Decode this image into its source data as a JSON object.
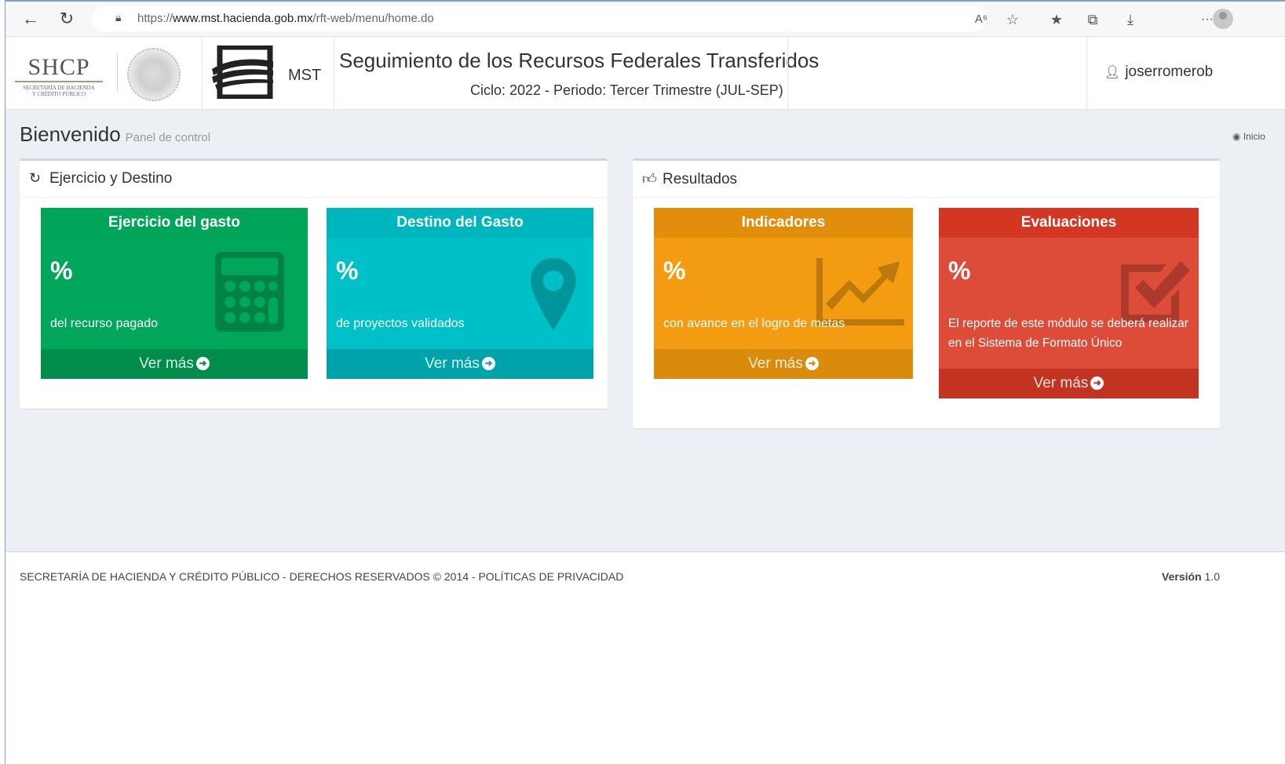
{
  "browser": {
    "url_scheme": "https://",
    "url_host": "www.mst.hacienda.gob.mx",
    "url_path": "/rft-web/menu/home.do",
    "more_label": "···"
  },
  "header": {
    "shcp_title": "SHCP",
    "shcp_sub_1": "SECRETARÍA DE HACIENDA",
    "shcp_sub_2": "Y CRÉDITO PÚBLICO",
    "mst_label": "MST",
    "title": "Seguimiento de los Recursos Federales Transferidos",
    "subtitle": "Ciclo: 2022 - Periodo: Tercer Trimestre (JUL-SEP)",
    "username": "joserromerob"
  },
  "page": {
    "title": "Bienvenido",
    "subtitle": "Panel de control",
    "breadcrumb": "Inicio"
  },
  "boxes": {
    "left_title": "Ejercicio y Destino",
    "right_title": "Resultados"
  },
  "tiles": [
    {
      "title": "Ejercicio del gasto",
      "pct": "%",
      "text": "del recurso pagado",
      "link": "Ver más"
    },
    {
      "title": "Destino del Gasto",
      "pct": "%",
      "text": "de proyectos validados",
      "link": "Ver más"
    },
    {
      "title": "Indicadores",
      "pct": "%",
      "text": "con avance en el logro de metas",
      "link": "Ver más"
    },
    {
      "title": "Evaluaciones",
      "pct": "%",
      "text": "El reporte de este módulo se deberá realizar en el Sistema de Formato Único",
      "link": "Ver más"
    }
  ],
  "footer": {
    "text": "SECRETARÍA DE HACIENDA Y CRÉDITO PÚBLICO - DERECHOS RESERVADOS © 2014 - POLÍTICAS DE PRIVACIDAD",
    "version_label": "Versión",
    "version_value": "1.0"
  },
  "colors": {
    "green": "#00a65a",
    "aqua": "#00c0c7",
    "orange": "#f39c12",
    "red": "#dd4b39",
    "content_bg": "#ecf0f5"
  },
  "icons": [
    "back-icon",
    "refresh-icon",
    "lock-icon",
    "read-aloud-icon",
    "favorite-add-icon",
    "favorites-icon",
    "collections-icon",
    "downloads-icon",
    "profile-icon",
    "user-icon",
    "refresh-box-icon",
    "thumbs-up-icon",
    "dashboard-icon",
    "calculator-icon",
    "map-marker-icon",
    "chart-line-icon",
    "checkbox-icon",
    "arrow-circle-right-icon"
  ]
}
